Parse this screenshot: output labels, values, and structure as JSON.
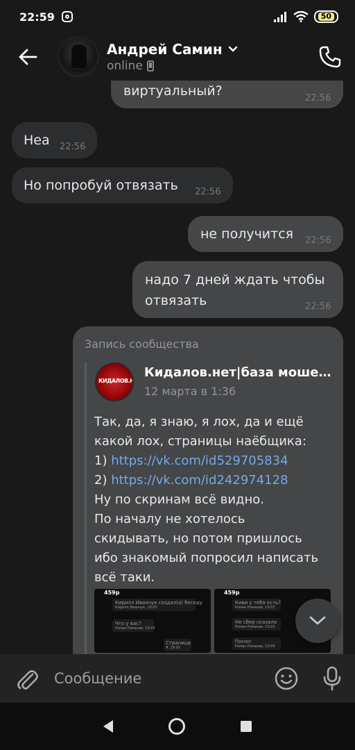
{
  "status_bar": {
    "time": "22:59",
    "battery": "50"
  },
  "header": {
    "contact_name": "Андрей Самин",
    "contact_status": "online"
  },
  "messages": [
    {
      "text": "виртуальный?",
      "time": "22:56",
      "direction": "out"
    },
    {
      "text": "Неа",
      "time": "22:56",
      "direction": "in"
    },
    {
      "text": "Но попробуй отвязать",
      "time": "22:56",
      "direction": "in"
    },
    {
      "text": "не получится",
      "time": "22:56",
      "direction": "out"
    },
    {
      "text_line1": "надо 7 дней ждать чтобы",
      "text_line2": "отвязать",
      "time": "22:56",
      "direction": "out"
    }
  ],
  "post": {
    "label": "Запись сообщества",
    "group_avatar_text": "КИДАЛОВ.НЕТ",
    "group_name": "Кидалов.нет|база мошенников",
    "date": "12 марта в 1:36",
    "line1": "Так, да, я знаю, я лох, да и ещё",
    "line2": "какой лох, страницы наёбщика:",
    "link1_prefix": "1) ",
    "link1": "https://vk.com/id529705834",
    "link2_prefix": "2) ",
    "link2": "https://vk.com/id242974128",
    "line5": "Ну по скринам всё видно.",
    "line6": "По началу не хотелось",
    "line7": "скидывать, но потом пришлось",
    "line8": "ибо знакомый попросил написать",
    "line9": "всё таки.",
    "thumb1": {
      "time": "459p",
      "rows": [
        "Кирилл Иванчук создал(а) беседу",
        "Что у вас?",
        "Страница"
      ],
      "subs": [
        "Кирилл Иванчук, 19:03",
        "Роман Романов, 19:03",
        "Я, 19:03"
      ]
    },
    "thumb2": {
      "time": "459p",
      "rows": [
        "Киви у тебя есть?",
        "Не сбер сказала",
        "Понял"
      ],
      "subs": [
        "Роман Романов, 15:03",
        "Роман Романов, 15:03",
        "Роман Романов, 15:04"
      ]
    }
  },
  "composer": {
    "placeholder": "Сообщение"
  },
  "colors": {
    "accent_link": "#71aaeb",
    "bubble_in": "#2c2d2e",
    "bubble_out": "#454647",
    "background": "#19191a"
  }
}
